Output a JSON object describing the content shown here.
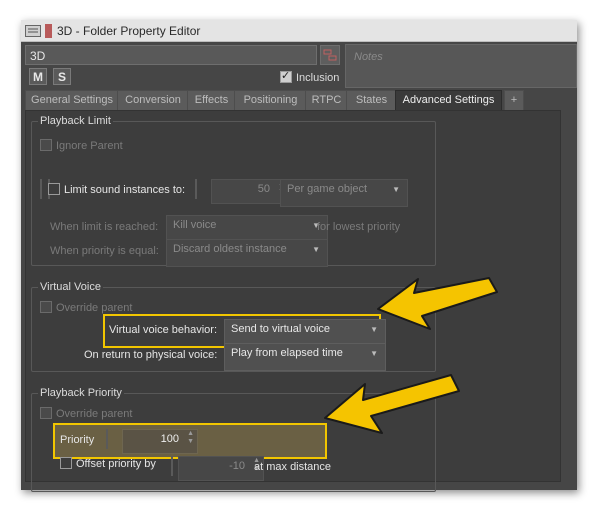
{
  "window": {
    "title": "3D - Folder Property Editor"
  },
  "object": {
    "name": "3D",
    "notes_placeholder": "Notes",
    "mute": "M",
    "solo": "S",
    "inclusion": "Inclusion"
  },
  "tabs": [
    {
      "label": "General Settings"
    },
    {
      "label": "Conversion"
    },
    {
      "label": "Effects"
    },
    {
      "label": "Positioning"
    },
    {
      "label": "RTPC"
    },
    {
      "label": "States"
    },
    {
      "label": "Advanced Settings",
      "active": true
    },
    {
      "label": "+"
    }
  ],
  "playback_limit": {
    "title": "Playback Limit",
    "ignore_parent": "Ignore Parent",
    "limit_label": "Limit sound instances to:",
    "limit_value": "50",
    "scope": "Per game object",
    "when_reached_label": "When limit is reached:",
    "when_reached_value": "Kill voice",
    "for_lowest": "for lowest priority",
    "when_equal_label": "When priority is equal:",
    "when_equal_value": "Discard oldest instance"
  },
  "virtual_voice": {
    "title": "Virtual Voice",
    "override_parent": "Override parent",
    "behavior_label": "Virtual voice behavior:",
    "behavior_value": "Send to virtual voice",
    "return_label": "On return to physical voice:",
    "return_value": "Play from elapsed time"
  },
  "playback_priority": {
    "title": "Playback Priority",
    "override_parent": "Override parent",
    "priority_label": "Priority",
    "priority_value": "100",
    "offset_label": "Offset priority by",
    "offset_value": "-10",
    "at_max": "at max distance"
  },
  "colors": {
    "highlight": "#f2c600",
    "arrow": "#f5c400",
    "window_bg": "#464646"
  }
}
